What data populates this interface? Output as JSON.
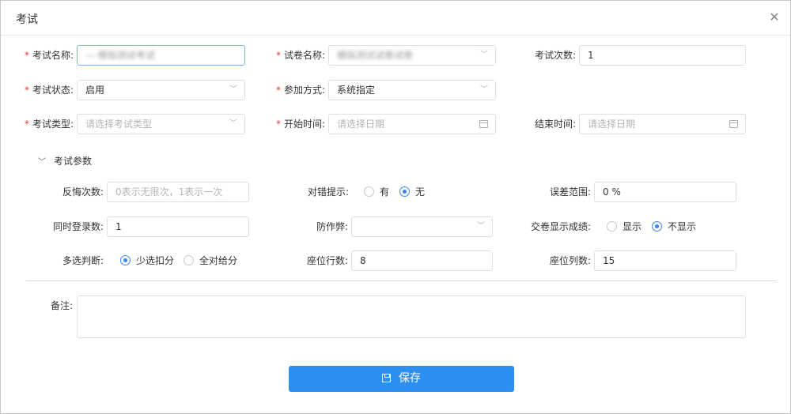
{
  "dialog": {
    "title": "考试",
    "close_icon": "close-icon"
  },
  "form": {
    "exam_name": {
      "label": "考试名称:",
      "value": "—·模拟测试考试"
    },
    "paper_name": {
      "label": "试卷名称:",
      "value": "模拟测试试卷试卷"
    },
    "exam_count": {
      "label": "考试次数:",
      "value": "1"
    },
    "exam_status": {
      "label": "考试状态:",
      "value": "启用"
    },
    "join_mode": {
      "label": "参加方式:",
      "value": "系统指定"
    },
    "exam_type": {
      "label": "考试类型:",
      "placeholder": "请选择考试类型"
    },
    "start_time": {
      "label": "开始时间:",
      "placeholder": "请选择日期"
    },
    "end_time": {
      "label": "结束时间:",
      "placeholder": "请选择日期"
    }
  },
  "params": {
    "section_title": "考试参数",
    "regret_count": {
      "label": "反悔次数:",
      "placeholder": "0表示无限次，1表示一次"
    },
    "correct_hint": {
      "label": "对错提示:",
      "options": [
        "有",
        "无"
      ],
      "selected": "无"
    },
    "error_range": {
      "label": "误差范围:",
      "value": "0 %"
    },
    "concurrent_logins": {
      "label": "同时登录数:",
      "value": "1"
    },
    "anti_cheat": {
      "label": "防作弊:",
      "value": ""
    },
    "show_score": {
      "label": "交卷显示成绩:",
      "options": [
        "显示",
        "不显示"
      ],
      "selected": "不显示"
    },
    "multi_choice": {
      "label": "多选判断:",
      "options": [
        "少选扣分",
        "全对给分"
      ],
      "selected": "少选扣分"
    },
    "seat_rows": {
      "label": "座位行数:",
      "value": "8"
    },
    "seat_cols": {
      "label": "座位列数:",
      "value": "15"
    }
  },
  "remark": {
    "label": "备注:",
    "value": ""
  },
  "save_button": {
    "label": "保存",
    "icon": "save-icon"
  },
  "colors": {
    "primary": "#2d8ff0",
    "required": "#e53935",
    "border": "#dcdfe6"
  }
}
